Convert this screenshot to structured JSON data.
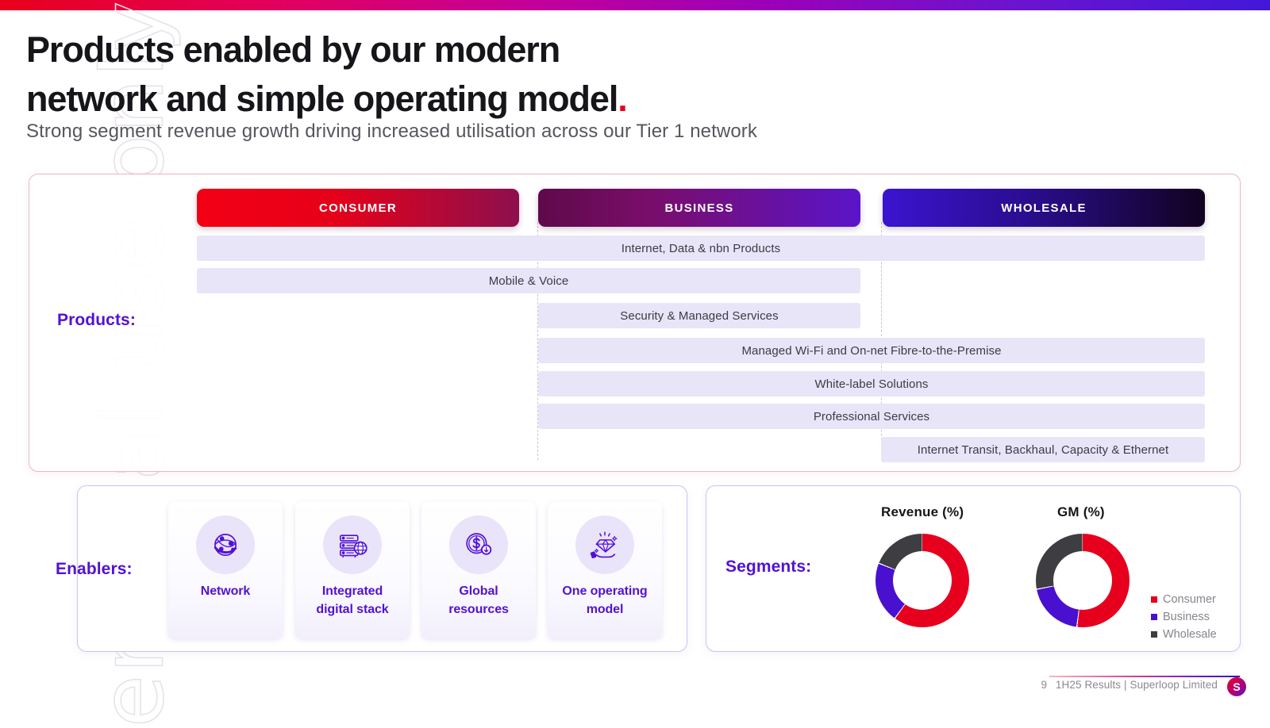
{
  "slide": {
    "title_line1": "Products enabled by our modern",
    "title_line2": "network and simple operating model",
    "title_dot": ".",
    "subtitle": "Strong segment revenue growth driving increased utilisation across our Tier 1 network",
    "watermark": "ersonal use only"
  },
  "labels": {
    "products": "Products:",
    "enablers": "Enablers:",
    "segments": "Segments:"
  },
  "segments_header": [
    {
      "name": "CONSUMER",
      "color": "#e60019"
    },
    {
      "name": "BUSINESS",
      "color": "#5a14c9"
    },
    {
      "name": "WHOLESALE",
      "color": "#2a0d8f"
    }
  ],
  "product_rows": [
    {
      "label": "Internet, Data & nbn Products",
      "spans": "consumer-business"
    },
    {
      "label": "Mobile & Voice",
      "spans": "consumer-business"
    },
    {
      "label": "Security & Managed Services",
      "spans": "business"
    },
    {
      "label": "Managed Wi-Fi and On-net Fibre-to-the-Premise",
      "spans": "business-wholesale"
    },
    {
      "label": "White-label Solutions",
      "spans": "business-wholesale"
    },
    {
      "label": "Professional Services",
      "spans": "business-wholesale"
    },
    {
      "label": "Internet Transit, Backhaul, Capacity & Ethernet",
      "spans": "wholesale"
    }
  ],
  "enablers": [
    {
      "label_line1": "Network",
      "label_line2": "",
      "icon": "network-globe-icon"
    },
    {
      "label_line1": "Integrated",
      "label_line2": "digital stack",
      "icon": "server-stack-globe-icon"
    },
    {
      "label_line1": "Global",
      "label_line2": "resources",
      "icon": "dollar-coin-icon"
    },
    {
      "label_line1": "One operating",
      "label_line2": "model",
      "icon": "diamond-in-hand-icon"
    }
  ],
  "chart_data": [
    {
      "type": "pie",
      "title": "Revenue (%)",
      "categories": [
        "Consumer",
        "Business",
        "Wholesale"
      ],
      "values": [
        60,
        21,
        19
      ],
      "colors": [
        "#e6001e",
        "#4a10cf",
        "#3d3d42"
      ],
      "legend_position": "right",
      "donut": true
    },
    {
      "type": "pie",
      "title": "GM (%)",
      "categories": [
        "Consumer",
        "Business",
        "Wholesale"
      ],
      "values": [
        52,
        20,
        28
      ],
      "colors": [
        "#e6001e",
        "#4a10cf",
        "#3d3d42"
      ],
      "legend_position": "right",
      "donut": true
    }
  ],
  "legend": [
    {
      "label": "Consumer",
      "color": "#e6001e"
    },
    {
      "label": "Business",
      "color": "#4a10cf"
    },
    {
      "label": "Wholesale",
      "color": "#3d3d42"
    }
  ],
  "footer": {
    "page": "9",
    "text": "1H25 Results | Superloop Limited",
    "logo_glyph": "S"
  }
}
